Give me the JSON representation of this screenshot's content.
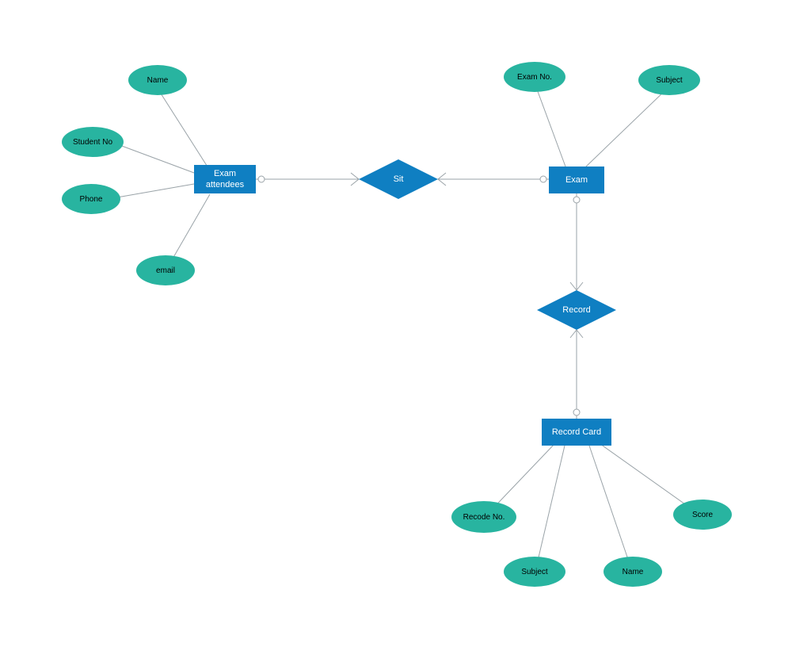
{
  "entities": {
    "exam_attendees": "Exam attendees",
    "exam": "Exam",
    "record_card": "Record Card"
  },
  "relationships": {
    "sit": "Sit",
    "record": "Record"
  },
  "attributes": {
    "name1": "Name",
    "student_no": "Student No",
    "phone": "Phone",
    "email": "email",
    "exam_no": "Exam No.",
    "subject1": "Subject",
    "recode_no": "Recode No.",
    "subject2": "Subject",
    "name2": "Name",
    "score": "Score"
  },
  "colors": {
    "entity": "#0f7fc2",
    "attr": "#28b4a0",
    "line": "#9aa3a8"
  }
}
